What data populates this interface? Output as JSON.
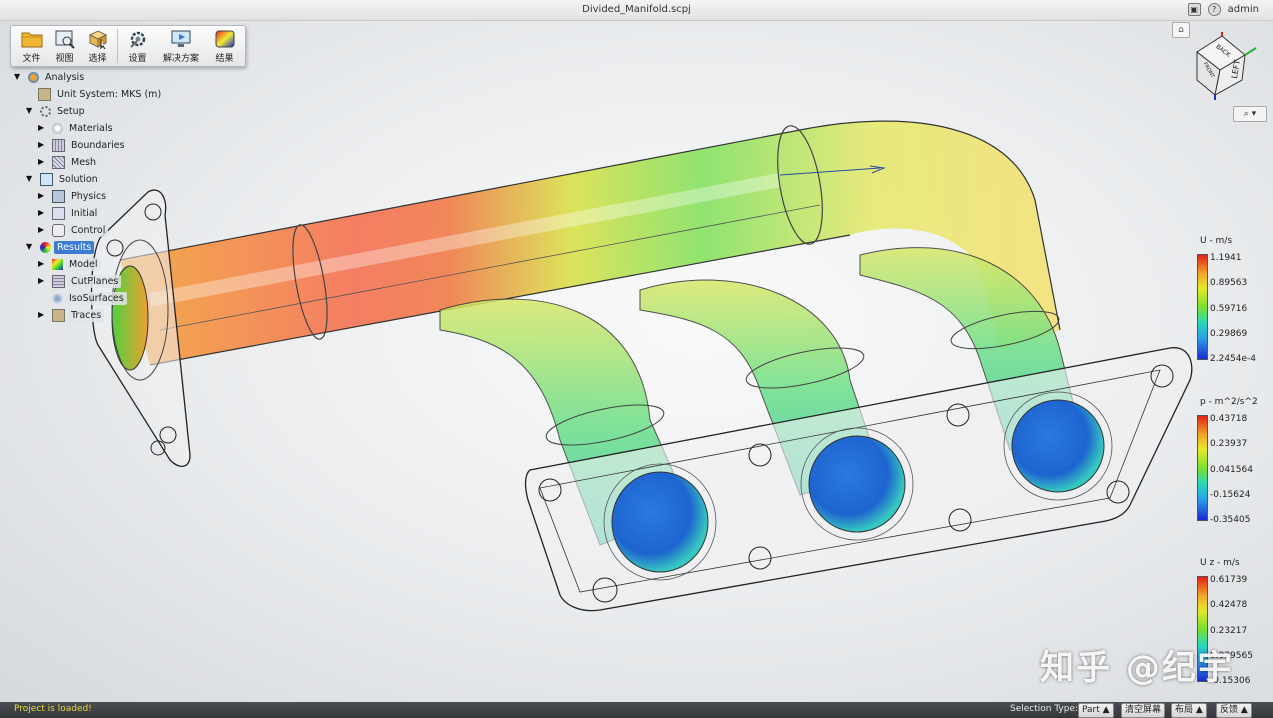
{
  "window": {
    "title": "Divided_Manifold.scpj",
    "user": "admin"
  },
  "toolbar": {
    "buttons": [
      {
        "label": "文件",
        "icon": "folder-icon"
      },
      {
        "label": "视图",
        "icon": "view-icon"
      },
      {
        "label": "选择",
        "icon": "select-icon"
      },
      {
        "label": "设置",
        "icon": "settings-gear-icon"
      },
      {
        "label": "解决方案",
        "icon": "solution-monitor-icon"
      },
      {
        "label": "结果",
        "icon": "results-icon"
      }
    ]
  },
  "tree": {
    "analysis": "Analysis",
    "unit_system": "Unit System: MKS (m)",
    "setup": "Setup",
    "materials": "Materials",
    "boundaries": "Boundaries",
    "mesh": "Mesh",
    "solution": "Solution",
    "physics": "Physics",
    "initial": "Initial",
    "control": "Control",
    "results": "Results",
    "model": "Model",
    "cutplanes": "CutPlanes",
    "isosurfaces": "IsoSurfaces",
    "traces": "Traces"
  },
  "viewcube": {
    "face_left": "LEFT",
    "face_back": "BACK",
    "face_side": "FRONT"
  },
  "legends": [
    {
      "title": "U - m/s",
      "ticks": [
        "1.1941",
        "0.89563",
        "0.59716",
        "0.29869",
        "2.2454e-4"
      ]
    },
    {
      "title": "p - m^2/s^2",
      "ticks": [
        "0.43718",
        "0.23937",
        "0.041564",
        "-0.15624",
        "-0.35405"
      ]
    },
    {
      "title": "U z - m/s",
      "ticks": [
        "0.61739",
        "0.42478",
        "0.23217",
        "0.039565",
        "-0.15306"
      ]
    }
  ],
  "status": {
    "message": "Project is loaded!",
    "selection_type_label": "Selection Type:",
    "selection_type_value": "Part",
    "clear_screen": "清空屏幕",
    "layout": "布局",
    "feedback": "反馈"
  },
  "watermark": "知乎 @纪宇",
  "colors": {
    "accent": "#3b7bd1",
    "status_text": "#e8d83a",
    "status_bg": "#3a3d42"
  }
}
